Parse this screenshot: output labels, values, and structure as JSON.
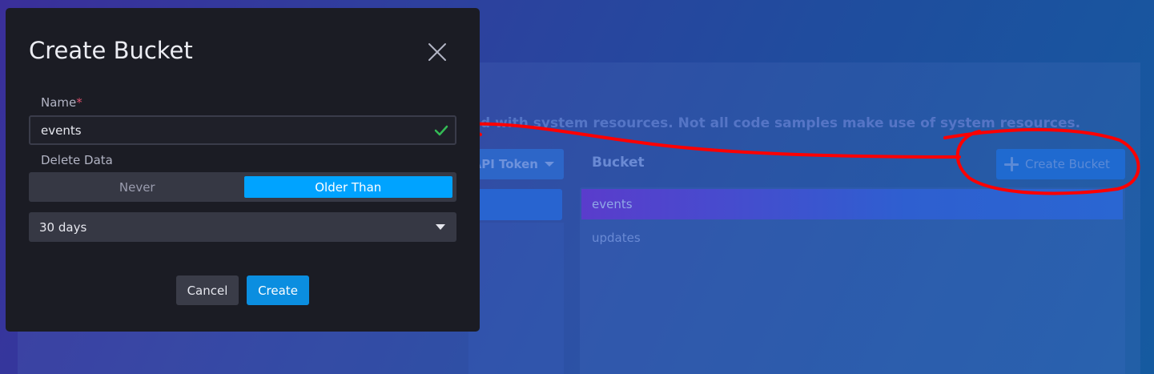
{
  "background": {
    "info_text": "d with system resources. Not all code samples make use of system resources.",
    "api_token_button_label": "API Token",
    "bucket_column_label": "Bucket",
    "create_bucket_button_label": "Create Bucket",
    "buckets": [
      {
        "name": "events",
        "selected": true
      },
      {
        "name": "updates",
        "selected": false
      }
    ]
  },
  "modal": {
    "title": "Create Bucket",
    "name_label": "Name",
    "required_marker": "*",
    "name_value": "events",
    "name_valid": true,
    "delete_data_label": "Delete Data",
    "delete_options": [
      {
        "label": "Never",
        "active": false
      },
      {
        "label": "Older Than",
        "active": true
      }
    ],
    "retention_selected": "30 days",
    "cancel_label": "Cancel",
    "create_label": "Create"
  },
  "colors": {
    "accent": "#00a3ff",
    "create_button": "#0b8ee0",
    "annotation": "#ff0000",
    "valid_check": "#34bb55",
    "required": "#e0506d"
  },
  "icons": [
    "close-icon",
    "check-icon",
    "chevron-down-icon",
    "plus-icon"
  ]
}
